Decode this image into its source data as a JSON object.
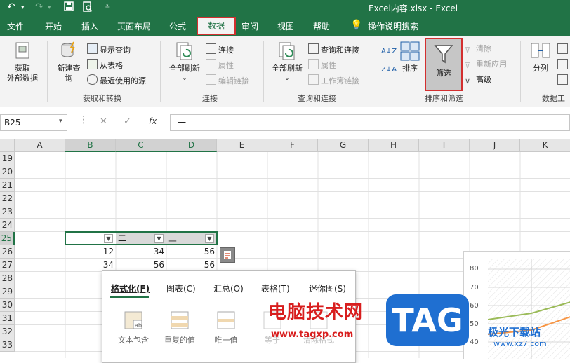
{
  "window": {
    "title": "Excel内容.xlsx  -  Excel"
  },
  "quick_access": {
    "undo_icon": "undo-icon",
    "redo_icon": "redo-icon",
    "save_icon": "save-icon",
    "print_preview_icon": "print-preview-icon",
    "customize_icon": "customize-qat-icon"
  },
  "tabs": [
    "文件",
    "开始",
    "插入",
    "页面布局",
    "公式",
    "数据",
    "审阅",
    "视图",
    "帮助",
    "操作说明搜索"
  ],
  "active_tab": "数据",
  "ribbon": {
    "get_external_data": "获取\n外部数据",
    "new_query": "新建查\n询",
    "show_queries": "显示查询",
    "from_table": "从表格",
    "recent_sources": "最近使用的源",
    "group_get_transform": "获取和转换",
    "refresh_all_1": "全部刷新",
    "connections": "连接",
    "properties_1": "属性",
    "edit_links": "编辑链接",
    "group_connections": "连接",
    "refresh_all_2": "全部刷新",
    "queries_connections": "查询和连接",
    "properties_2": "属性",
    "workbook_links": "工作簿链接",
    "group_queries_connections": "查询和连接",
    "sort": "排序",
    "filter": "筛选",
    "clear": "清除",
    "reapply": "重新应用",
    "advanced": "高级",
    "group_sort_filter": "排序和筛选",
    "text_to_columns": "分列",
    "group_data_tools": "数据工"
  },
  "formula_bar": {
    "name_box": "B25",
    "cancel": "✕",
    "enter": "✓",
    "fx": "fx",
    "content": "一"
  },
  "columns": [
    "A",
    "B",
    "C",
    "D",
    "E",
    "F",
    "G",
    "H",
    "I",
    "J",
    "K"
  ],
  "rows": [
    "19",
    "20",
    "21",
    "22",
    "23",
    "24",
    "25",
    "26",
    "27",
    "28",
    "29",
    "30",
    "31",
    "32",
    "33"
  ],
  "table": {
    "headers": [
      "一",
      "二",
      "三"
    ],
    "rows": [
      [
        "12",
        "34",
        "56"
      ],
      [
        "34",
        "56",
        "56"
      ]
    ]
  },
  "quick_analysis": {
    "tabs": [
      "格式化(F)",
      "图表(C)",
      "汇总(O)",
      "表格(T)",
      "迷你图(S)"
    ],
    "items": [
      "文本包含",
      "重复的值",
      "唯一值",
      "等于",
      "清除格式"
    ]
  },
  "chart": {
    "y_ticks": [
      "80",
      "70",
      "60",
      "50",
      "40"
    ]
  },
  "watermark": {
    "text": "电脑技术网",
    "url": "www.tagxp.com",
    "logo": "TAG",
    "site": "极光下载站",
    "site_url": "www.xz7.com"
  }
}
